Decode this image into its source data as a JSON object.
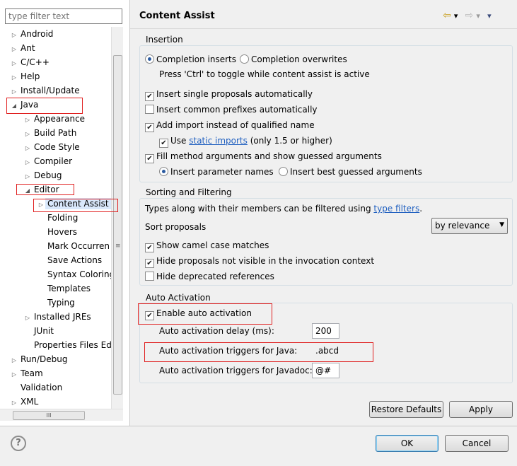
{
  "filter": {
    "placeholder": "type filter text"
  },
  "tree": [
    {
      "label": "Android",
      "indent": 0,
      "twisty": "▷"
    },
    {
      "label": "Ant",
      "indent": 0,
      "twisty": "▷"
    },
    {
      "label": "C/C++",
      "indent": 0,
      "twisty": "▷"
    },
    {
      "label": "Help",
      "indent": 0,
      "twisty": "▷"
    },
    {
      "label": "Install/Update",
      "indent": 0,
      "twisty": "▷"
    },
    {
      "label": "Java",
      "indent": 0,
      "twisty": "◢"
    },
    {
      "label": "Appearance",
      "indent": 1,
      "twisty": "▷"
    },
    {
      "label": "Build Path",
      "indent": 1,
      "twisty": "▷"
    },
    {
      "label": "Code Style",
      "indent": 1,
      "twisty": "▷"
    },
    {
      "label": "Compiler",
      "indent": 1,
      "twisty": "▷"
    },
    {
      "label": "Debug",
      "indent": 1,
      "twisty": "▷"
    },
    {
      "label": "Editor",
      "indent": 1,
      "twisty": "◢"
    },
    {
      "label": "Content Assist",
      "indent": 2,
      "twisty": "▷",
      "selected": true
    },
    {
      "label": "Folding",
      "indent": 2,
      "twisty": ""
    },
    {
      "label": "Hovers",
      "indent": 2,
      "twisty": ""
    },
    {
      "label": "Mark Occurren",
      "indent": 2,
      "twisty": ""
    },
    {
      "label": "Save Actions",
      "indent": 2,
      "twisty": ""
    },
    {
      "label": "Syntax Coloring",
      "indent": 2,
      "twisty": ""
    },
    {
      "label": "Templates",
      "indent": 2,
      "twisty": ""
    },
    {
      "label": "Typing",
      "indent": 2,
      "twisty": ""
    },
    {
      "label": "Installed JREs",
      "indent": 1,
      "twisty": "▷"
    },
    {
      "label": "JUnit",
      "indent": 1,
      "twisty": ""
    },
    {
      "label": "Properties Files Ed",
      "indent": 1,
      "twisty": ""
    },
    {
      "label": "Run/Debug",
      "indent": 0,
      "twisty": "▷"
    },
    {
      "label": "Team",
      "indent": 0,
      "twisty": "▷"
    },
    {
      "label": "Validation",
      "indent": 0,
      "twisty": ""
    },
    {
      "label": "XML",
      "indent": 0,
      "twisty": "▷"
    }
  ],
  "page": {
    "title": "Content Assist",
    "nav": {
      "back": "⇦",
      "back_menu": "▾",
      "forward": "⇨",
      "forward_menu": "▾",
      "view_menu": "▾"
    }
  },
  "insertion": {
    "title": "Insertion",
    "completion_inserts": "Completion inserts",
    "completion_overwrites": "Completion overwrites",
    "ctrl_hint": "Press 'Ctrl' to toggle while content assist is active",
    "single_proposals": "Insert single proposals automatically",
    "common_prefixes": "Insert common prefixes automatically",
    "add_import": "Add import instead of qualified name",
    "use_static_pre": "Use",
    "static_imports_link": "static imports",
    "use_static_post": "(only 1.5 or higher)",
    "fill_method_args": "Fill method arguments and show guessed arguments",
    "insert_param_names": "Insert parameter names",
    "insert_best_guessed": "Insert best guessed arguments"
  },
  "sorting": {
    "title": "Sorting and Filtering",
    "types_text_pre": "Types along with their members can be filtered using",
    "type_filters_link": "type filters",
    "types_text_post": ".",
    "sort_proposals": "Sort proposals",
    "sort_value": "by relevance",
    "camel_case": "Show camel case matches",
    "hide_not_visible": "Hide proposals not visible in the invocation context",
    "hide_deprecated": "Hide deprecated references"
  },
  "auto": {
    "title": "Auto Activation",
    "enable": "Enable auto activation",
    "delay_label": "Auto activation delay (ms):",
    "delay_value": "200",
    "java_triggers_label": "Auto activation triggers for Java:",
    "java_triggers_value": ".abcd",
    "javadoc_triggers_label": "Auto activation triggers for Javadoc:",
    "javadoc_triggers_value": "@#"
  },
  "buttons": {
    "restore_defaults": "Restore Defaults",
    "apply": "Apply",
    "ok": "OK",
    "cancel": "Cancel"
  },
  "icons": {
    "check": "✔",
    "help": "?",
    "dropdown": "▼",
    "scroll_grip": "≡",
    "hscroll_grip": "III"
  },
  "colors": {
    "highlight_box": "#e02020",
    "link": "#2060c0",
    "selected_bg": "#d9e8fb"
  }
}
